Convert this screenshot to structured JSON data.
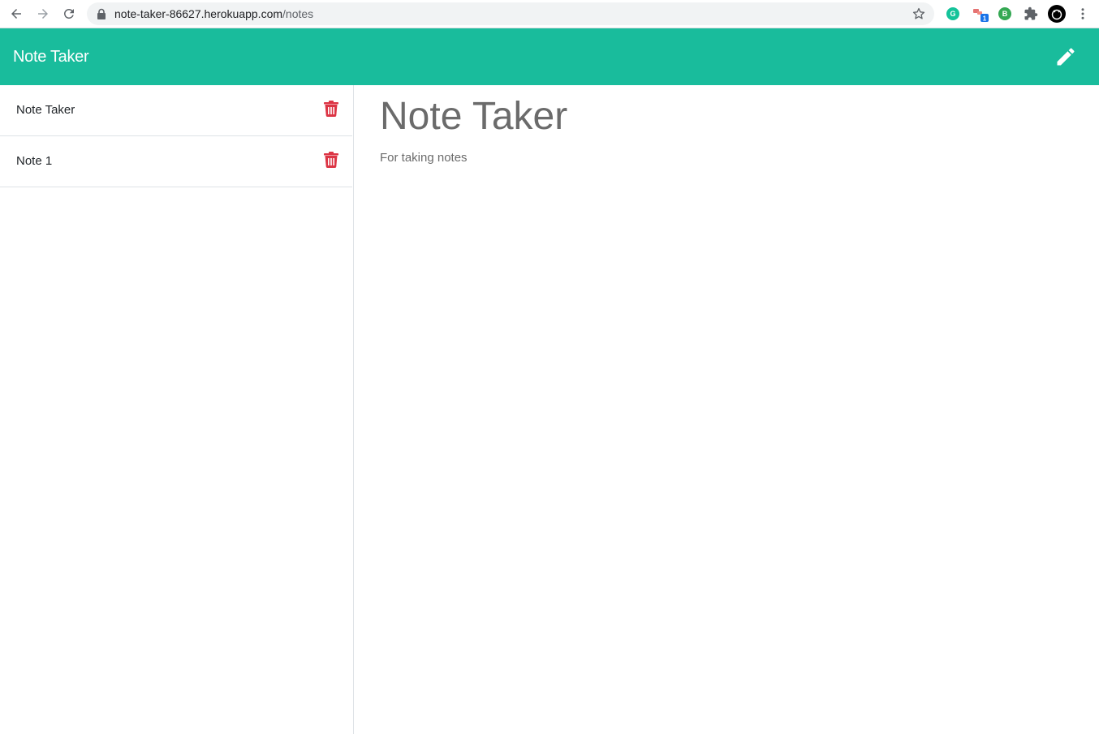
{
  "browser": {
    "url_host": "note-taker-86627.herokuapp.com",
    "url_path": "/notes",
    "icons": [
      "back-icon",
      "forward-icon",
      "reload-icon",
      "lock-icon",
      "bookmark-star-icon",
      "grammarly-extension-icon",
      "extension-badge-icon",
      "b-extension-icon",
      "extensions-puzzle-icon",
      "profile-avatar-icon",
      "menu-kebab-icon"
    ],
    "ext_badge_count": "1",
    "b_ext_letter": "B",
    "colors": {
      "grammarly": "#15c39a",
      "b_ext": "#34a853",
      "badge": "#1a73e8"
    }
  },
  "navbar": {
    "brand": "Note Taker",
    "new_note_icon": "pencil-icon",
    "background": "#19bc9c"
  },
  "sidebar": {
    "notes": [
      {
        "title": "Note Taker",
        "delete_icon": "trash-icon"
      },
      {
        "title": "Note 1",
        "delete_icon": "trash-icon"
      }
    ],
    "delete_color": "#dc3545"
  },
  "main": {
    "note_title": "Note Taker",
    "note_text": "For taking notes"
  }
}
